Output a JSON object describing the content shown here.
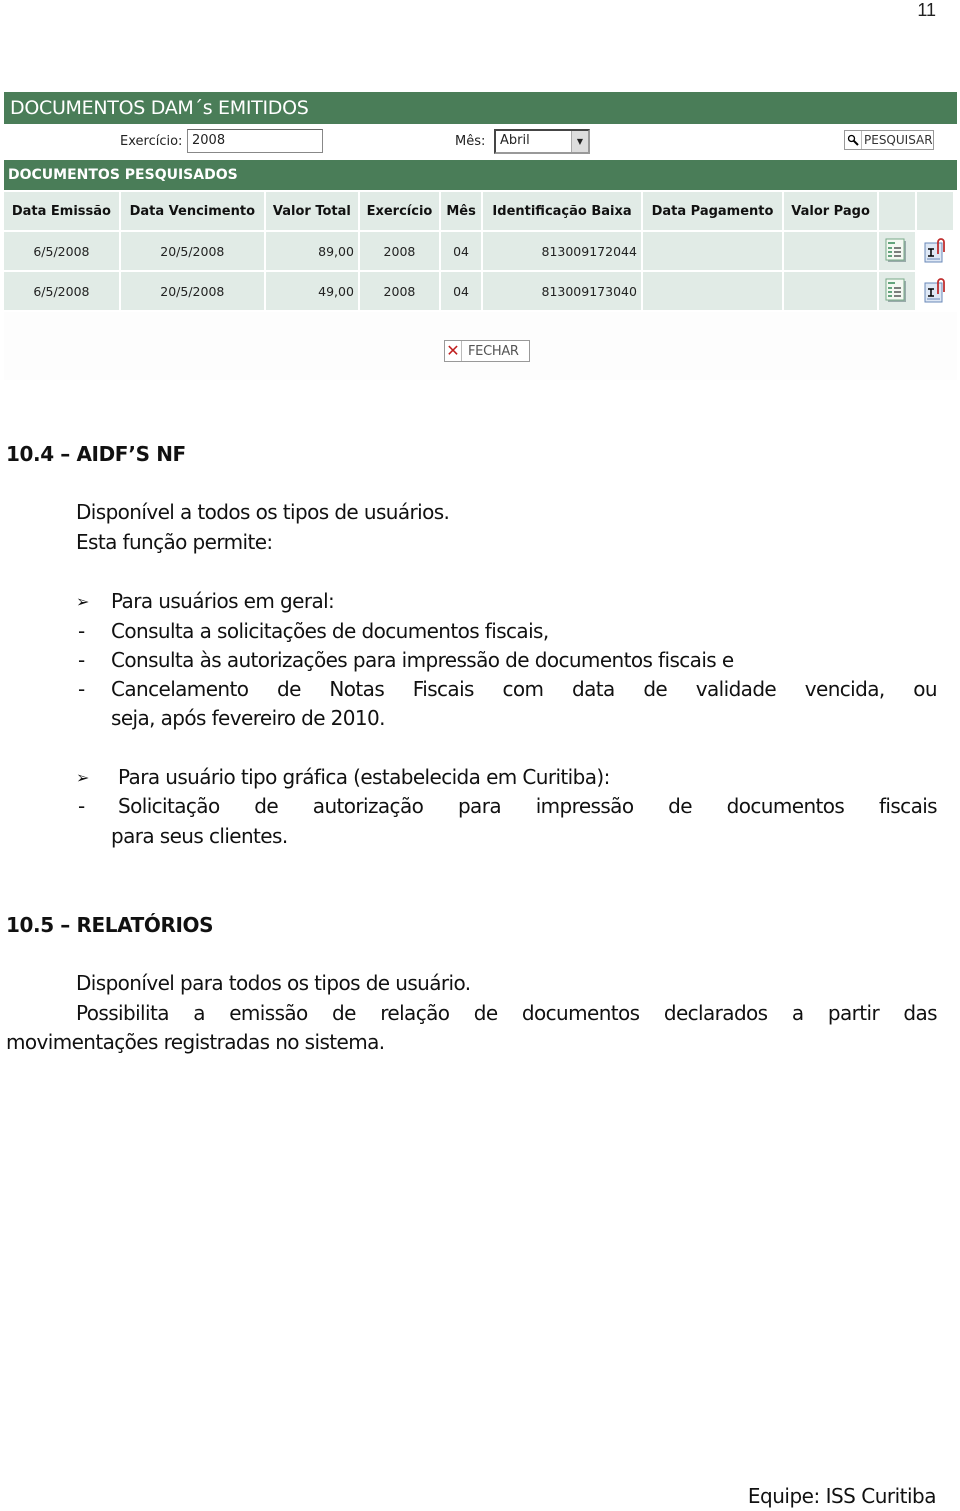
{
  "page_number": "11",
  "ui": {
    "title": "DOCUMENTOS DAM´s EMITIDOS",
    "search": {
      "exercicio_label": "Exercício:",
      "exercicio_value": "2008",
      "mes_label": "Mês:",
      "mes_value": "Abril",
      "search_button": "PESQUISAR"
    },
    "results_title": "DOCUMENTOS PESQUISADOS",
    "table": {
      "headers": [
        "Data Emissão",
        "Data Vencimento",
        "Valor Total",
        "Exercício",
        "Mês",
        "Identificação Baixa",
        "Data Pagamento",
        "Valor Pago"
      ],
      "rows": [
        {
          "data_emissao": "6/5/2008",
          "data_vencimento": "20/5/2008",
          "valor_total": "89,00",
          "exercicio": "2008",
          "mes": "04",
          "identificacao_baixa": "813009172044",
          "data_pagamento": "",
          "valor_pago": ""
        },
        {
          "data_emissao": "6/5/2008",
          "data_vencimento": "20/5/2008",
          "valor_total": "49,00",
          "exercicio": "2008",
          "mes": "04",
          "identificacao_baixa": "813009173040",
          "data_pagamento": "",
          "valor_pago": ""
        }
      ],
      "row_actions": [
        "view-details-icon",
        "print-attach-icon"
      ]
    },
    "close_button": "FECHAR"
  },
  "section_104": {
    "heading": "10.4 – AIDF’S NF",
    "intro_1": "Disponível a todos os tipos de usuários.",
    "intro_2": "Esta função permite:",
    "group_1": {
      "title": "Para usuários em geral:",
      "items": [
        "Consulta a solicitações de documentos fiscais,",
        "Consulta às autorizações para impressão de documentos fiscais e",
        "Cancelamento de Notas Fiscais com data de validade vencida, ou",
        "seja, após fevereiro de 2010."
      ]
    },
    "group_2": {
      "title": "Para usuário tipo gráfica (estabelecida em Curitiba):",
      "items": [
        "Solicitação de autorização para impressão de documentos fiscais",
        "para seus clientes."
      ]
    }
  },
  "section_105": {
    "heading": "10.5 – RELATÓRIOS",
    "para_1": "Disponível para todos os tipos de usuário.",
    "para_2_line1": "Possibilita a emissão de relação de documentos declarados a partir das",
    "para_2_line2": "movimentações registradas no sistema."
  },
  "footer": "Equipe: ISS Curitiba"
}
